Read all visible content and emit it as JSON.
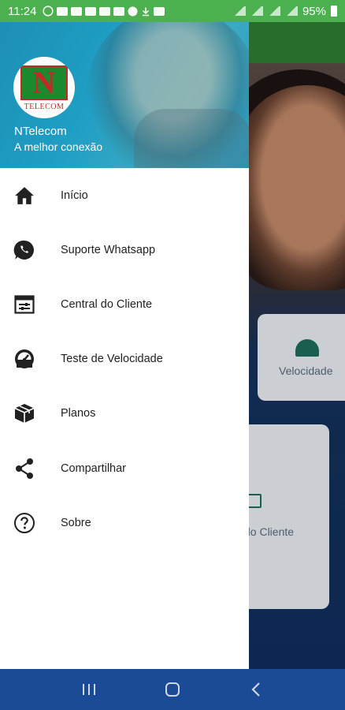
{
  "status_bar": {
    "time": "11:24",
    "battery": "95%"
  },
  "drawer": {
    "brand_name": "NTelecom",
    "tagline": "A melhor conexão",
    "logo": {
      "letter": "N",
      "text": "TELECOM"
    },
    "items": [
      {
        "label": "Início",
        "icon": "home-icon"
      },
      {
        "label": "Suporte Whatsapp",
        "icon": "whatsapp-icon"
      },
      {
        "label": "Central do Cliente",
        "icon": "client-panel-icon"
      },
      {
        "label": "Teste de Velocidade",
        "icon": "speedometer-icon"
      },
      {
        "label": "Planos",
        "icon": "package-icon"
      },
      {
        "label": "Compartilhar",
        "icon": "share-icon"
      },
      {
        "label": "Sobre",
        "icon": "help-circle-icon"
      }
    ]
  },
  "background": {
    "card_speed_label": "Velocidade",
    "card_client_label": "do Cliente"
  },
  "colors": {
    "status_bar": "#4caf50",
    "header": "#1f9ec4",
    "nav_bar": "#1b4a96",
    "icon": "#212121"
  }
}
